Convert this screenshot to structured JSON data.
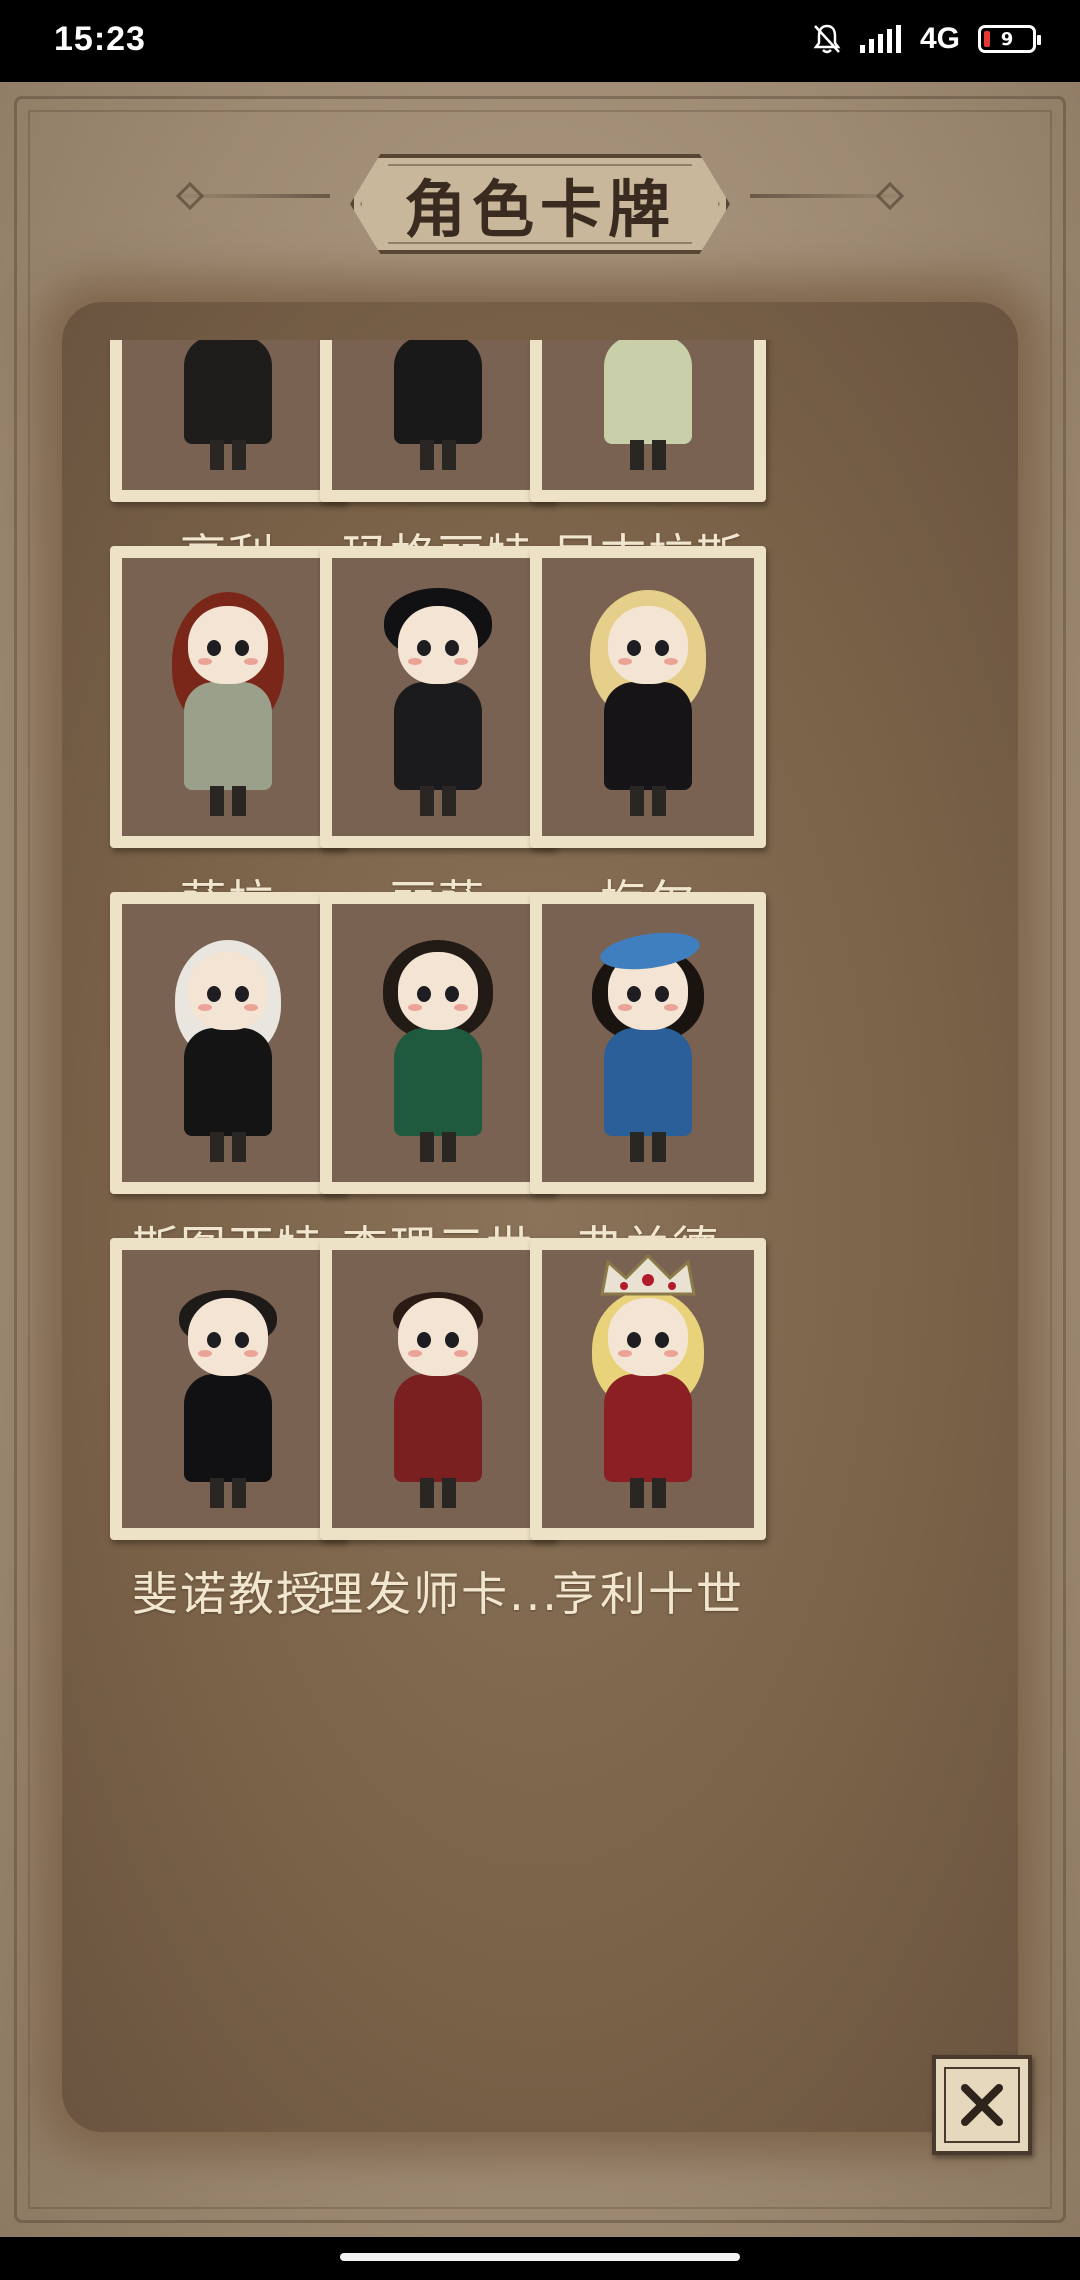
{
  "status_bar": {
    "time": "15:23",
    "network": "4G",
    "battery_level": "9"
  },
  "title": "角色卡牌",
  "colors": {
    "name_text": "#f1e6cf",
    "card_frame": "#ede1c6",
    "portrait_bg": "#7a6253",
    "parchment": "#a6927a"
  },
  "cards": [
    {
      "name": "亨利",
      "look": "dark-suit"
    },
    {
      "name": "玛格丽特",
      "look": "dark-dress"
    },
    {
      "name": "尼古拉斯",
      "look": "priest-robe"
    },
    {
      "name": "萨拉",
      "look": "red-hair-maid"
    },
    {
      "name": "丽萨",
      "look": "black-hair-maid"
    },
    {
      "name": "梅尔",
      "look": "blonde-dress"
    },
    {
      "name": "斯图亚特",
      "look": "white-beard-elder"
    },
    {
      "name": "查理三世",
      "look": "green-noble"
    },
    {
      "name": "弗兰德",
      "look": "blue-beret-noble"
    },
    {
      "name": "斐诺教授",
      "look": "black-robe-professor"
    },
    {
      "name": "理发师卡...",
      "look": "red-barber"
    },
    {
      "name": "亨利十世",
      "look": "crowned-king"
    }
  ],
  "close_button": {
    "icon": "close-icon"
  }
}
